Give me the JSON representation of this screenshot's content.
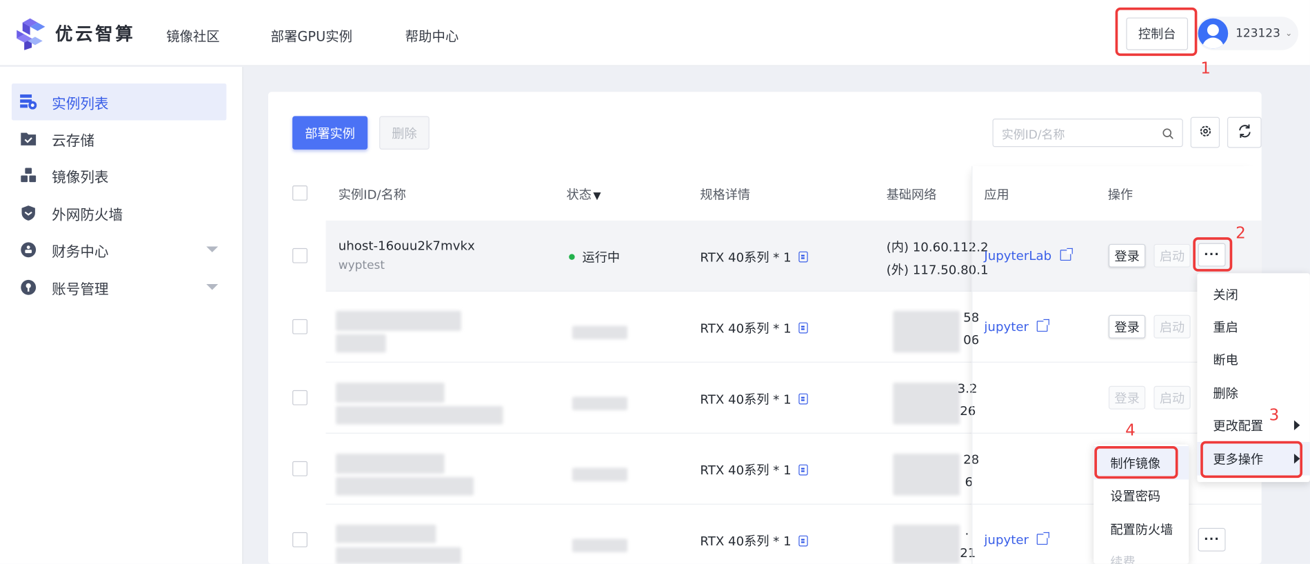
{
  "brand": {
    "name": "优云智算"
  },
  "nav": {
    "items": [
      "镜像社区",
      "部署GPU实例",
      "帮助中心"
    ]
  },
  "header": {
    "console_label": "控制台",
    "user_name": "123123"
  },
  "sidebar": {
    "items": [
      {
        "label": "实例列表",
        "icon": "server-list-icon",
        "active": true
      },
      {
        "label": "云存储",
        "icon": "folder-icon"
      },
      {
        "label": "镜像列表",
        "icon": "cubes-icon"
      },
      {
        "label": "外网防火墙",
        "icon": "shield-icon"
      },
      {
        "label": "财务中心",
        "icon": "finance-icon",
        "expandable": true
      },
      {
        "label": "账号管理",
        "icon": "account-icon",
        "expandable": true
      }
    ]
  },
  "toolbar": {
    "deploy_label": "部署实例",
    "delete_label": "删除",
    "search_placeholder": "实例ID/名称"
  },
  "table": {
    "columns": [
      "实例ID/名称",
      "状态",
      "规格详情",
      "基础网络",
      "应用",
      "操作"
    ],
    "rows": [
      {
        "id": "uhost-16ouu2k7mvkx",
        "name": "wyptest",
        "status": "运行中",
        "spec": "RTX 40系列 * 1",
        "net_in": "(内) 10.60.112.2",
        "net_out": "(外) 117.50.80.1",
        "app": "JupyterLab",
        "login": "登录",
        "start": "启动",
        "more": "···"
      },
      {
        "spec": "RTX 40系列 * 1",
        "net_in": "58",
        "net_out": "06",
        "app": "jupyter",
        "login": "登录",
        "start": "启动"
      },
      {
        "spec": "RTX 40系列 * 1",
        "net_in": "3.2",
        "net_out": "26",
        "login": "登录",
        "start": "启动"
      },
      {
        "spec": "RTX 40系列 * 1",
        "net_in": "28",
        "net_out": "6"
      },
      {
        "spec": "RTX 40系列 * 1",
        "net_in": ".",
        "net_out": "21",
        "app": "jupyter",
        "more": "···"
      }
    ]
  },
  "more_menu": {
    "items": [
      "关闭",
      "重启",
      "断电",
      "删除",
      "更改配置",
      "更多操作"
    ]
  },
  "sub_menu": {
    "items": [
      "制作镜像",
      "设置密码",
      "配置防火墙",
      "续费"
    ]
  },
  "annotations": {
    "labels": [
      "1",
      "2",
      "3",
      "4"
    ],
    "color": "#ee3a3a"
  },
  "colors": {
    "accent": "#4b72f5",
    "link": "#3a5fe8",
    "running": "#22b14c"
  }
}
